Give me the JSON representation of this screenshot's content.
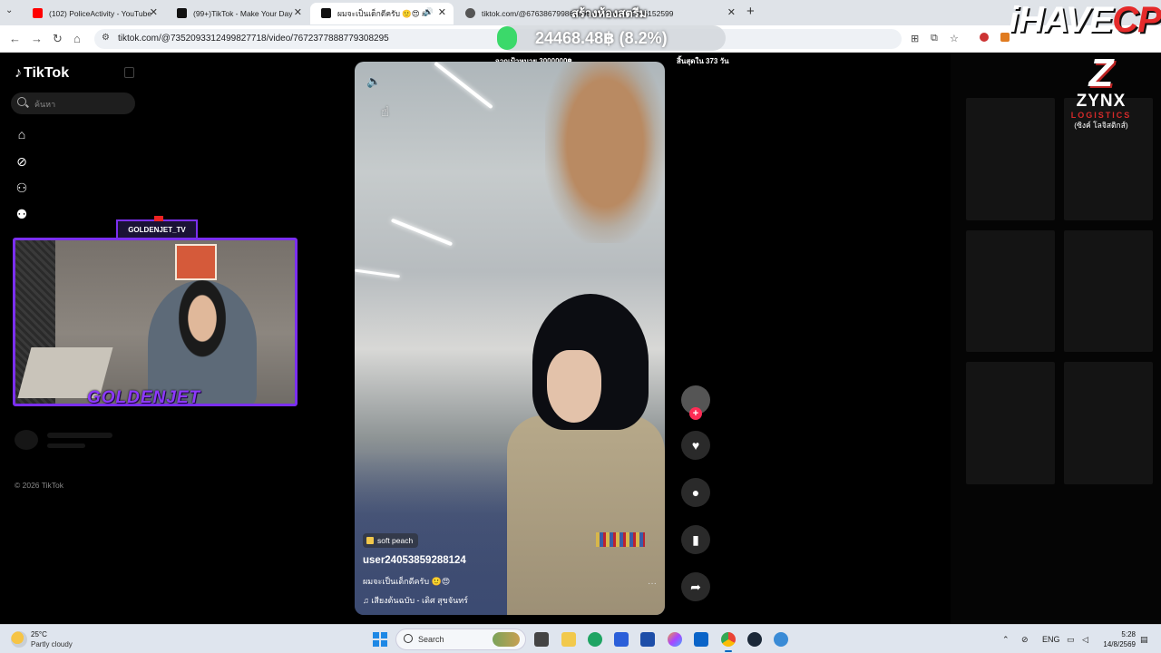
{
  "browser": {
    "tabs": [
      {
        "title": "(102) PoliceActivity - YouTube",
        "favicon_color": "#ff0000"
      },
      {
        "title": "(99+)TikTok - Make Your Day",
        "favicon_color": "#111111"
      },
      {
        "title": "ผมจะเป็นเด็กดีครับ 🙂😍 #ไว้เป็...",
        "favicon_color": "#111111"
      },
      {
        "title": "tiktok.com/@676386799862698...m/@76182285152599",
        "favicon_color": "#555555"
      }
    ],
    "url": "tiktok.com/@7352093312499827718/video/7672377888779308295"
  },
  "overlay": {
    "money": "24468.48฿ (8.2%)",
    "promo": "สร้างห้องสตรีม",
    "brand_a": "iHAVE",
    "brand_b": "CPU",
    "goal_left": "จากเป้าหมาย 3000000฿",
    "goal_right": "สิ้นสุดใน 373 วัน",
    "webcam_top_label": "GOLDENJET_TV",
    "webcam_bottom_label": "GOLDENJET",
    "sponsor_logo": "Z",
    "sponsor_name": "ZYNX",
    "sponsor_sub": "LOGISTICS",
    "sponsor_thai": "(ซิงค์ โลจิสติกส์)"
  },
  "tiktok": {
    "logo": "TikTok",
    "search_placeholder": "ค้นหา",
    "nav_icons": [
      "home-icon",
      "explore-icon",
      "following-icon",
      "friends-icon"
    ],
    "copyright": "© 2026 TikTok",
    "video": {
      "tag": "soft peach",
      "username": "user24053859288124",
      "caption": "ผมจะเป็นเด็กดีครับ 🙂😍",
      "music": "♫  เสียงต้นฉบับ - เดิศ สุขจันทร์",
      "more": "···"
    },
    "actions": [
      "like-icon",
      "comment-icon",
      "bookmark-icon",
      "share-icon"
    ]
  },
  "taskbar": {
    "temperature": "25°C",
    "weather": "Partly cloudy",
    "search_label": "Search",
    "language": "ENG",
    "time": "5:28",
    "date": "14/8/2569"
  }
}
